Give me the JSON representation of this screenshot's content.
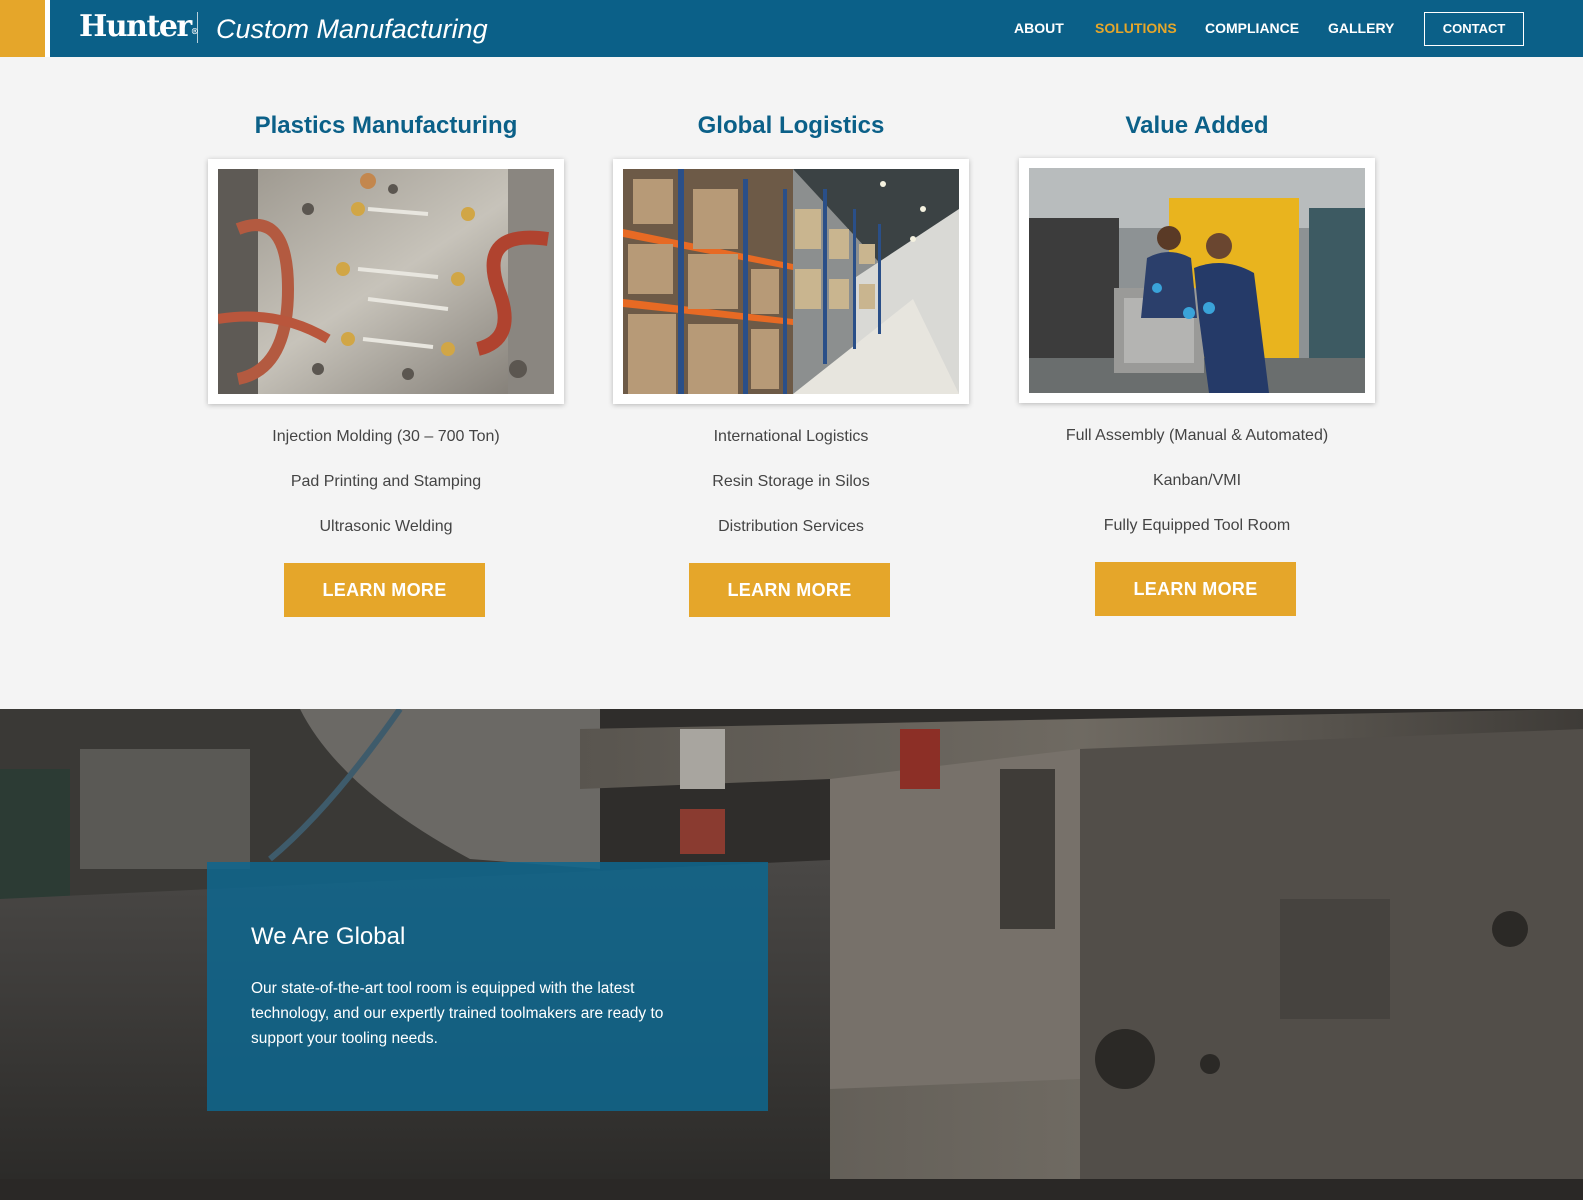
{
  "header": {
    "logo": "Hunter",
    "logo_mark": "®",
    "tagline": "Custom Manufacturing",
    "nav": [
      "ABOUT",
      "SOLUTIONS",
      "COMPLIANCE",
      "GALLERY"
    ],
    "active_nav": "SOLUTIONS",
    "contact_label": "CONTACT"
  },
  "columns": [
    {
      "title": "Plastics Manufacturing",
      "image": "injection-mold-photo",
      "items": [
        "Injection Molding (30 – 700 Ton)",
        "Pad Printing and Stamping",
        "Ultrasonic Welding"
      ],
      "button": "LEARN MORE"
    },
    {
      "title": "Global Logistics",
      "image": "warehouse-photo",
      "items": [
        "International Logistics",
        "Resin Storage in Silos",
        "Distribution Services"
      ],
      "button": "LEARN MORE"
    },
    {
      "title": "Value Added",
      "image": "workers-assembly-photo",
      "items": [
        "Full Assembly (Manual & Automated)",
        "Kanban/VMI",
        "Fully Equipped Tool Room"
      ],
      "button": "LEARN MORE"
    }
  ],
  "hero": {
    "title": "We Are Global",
    "text": "Our state-of-the-art tool room is equipped with the latest technology, and our expertly trained toolmakers are ready to support your tooling needs."
  },
  "colors": {
    "primary_blue": "#0b6088",
    "accent_gold": "#e5a62a",
    "background": "#f4f4f4"
  }
}
